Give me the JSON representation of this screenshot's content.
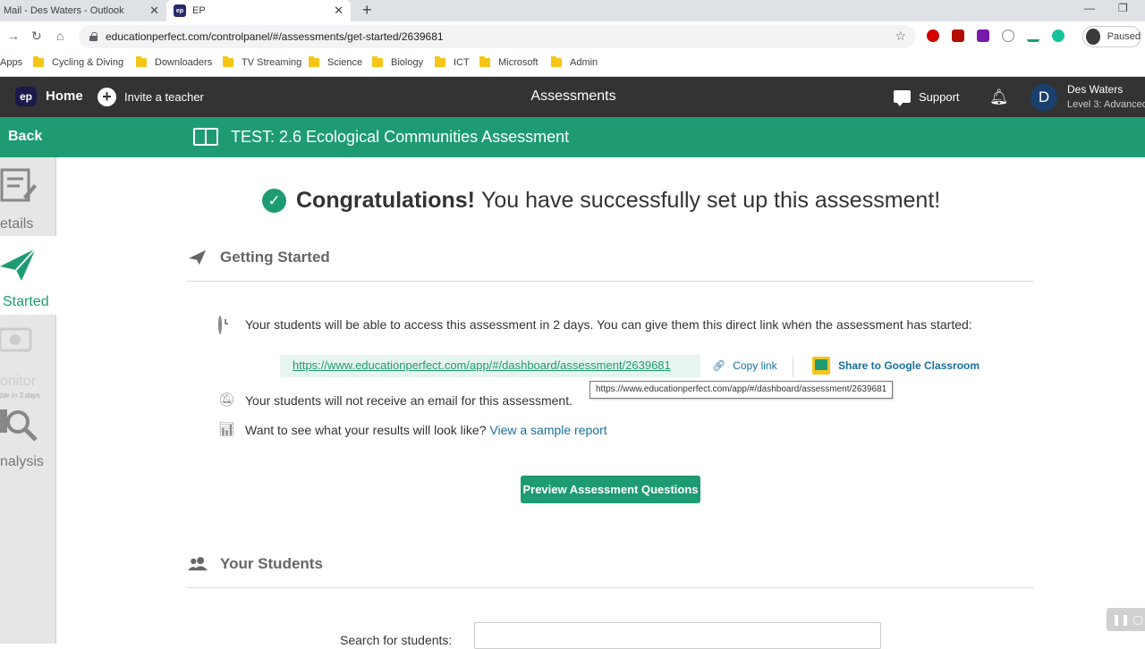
{
  "browser": {
    "tabs": [
      {
        "label": "Mail - Des Waters - Outlook"
      },
      {
        "label": "EP",
        "favicon": "ep"
      }
    ],
    "url": "educationperfect.com/controlpanel/#/assessments/get-started/2639681",
    "profile_label": "Paused",
    "bookmarks": [
      "Apps",
      "Cycling & Diving",
      "Downloaders",
      "TV Streaming",
      "Science",
      "Biology",
      "ICT",
      "Microsoft",
      "Admin"
    ]
  },
  "header": {
    "logo": "ep",
    "home_label": "Home",
    "invite_label": "Invite a teacher",
    "title": "Assessments",
    "support_label": "Support",
    "user_initial": "D",
    "user_name": "Des Waters",
    "user_level": "Level 3: Advanced"
  },
  "titlebar": {
    "back_label": "Back",
    "test_title": "TEST: 2.6 Ecological Communities Assessment"
  },
  "sidebar": {
    "items": [
      {
        "label": "etails"
      },
      {
        "label": "Started"
      },
      {
        "label": "onitor",
        "sublabel": "ble in 3 days"
      },
      {
        "label": "nalysis"
      }
    ]
  },
  "main": {
    "congrats_bold": "Congratulations!",
    "congrats_rest": "You have successfully set up this assessment!",
    "getting_started_heading": "Getting Started",
    "access_text": "Your students will be able to access this assessment in 2 days. You can give them this direct link when the assessment has started:",
    "direct_link": "https://www.educationperfect.com/app/#/dashboard/assessment/2639681",
    "copy_link_label": "Copy link",
    "google_classroom_label": "Share to Google Classroom",
    "tooltip": "https://www.educationperfect.com/app/#/dashboard/assessment/2639681",
    "email_text": "Your students will not receive an email for this assessment.",
    "sample_prefix": "Want to see what your results will look like?",
    "sample_link": "View a sample report",
    "preview_button": "Preview Assessment Questions",
    "students_heading": "Your Students",
    "search_label": "Search for students:"
  },
  "colors": {
    "brand_green": "#1e9b72",
    "header_dark": "#333333",
    "link_blue": "#1a6f9e"
  }
}
